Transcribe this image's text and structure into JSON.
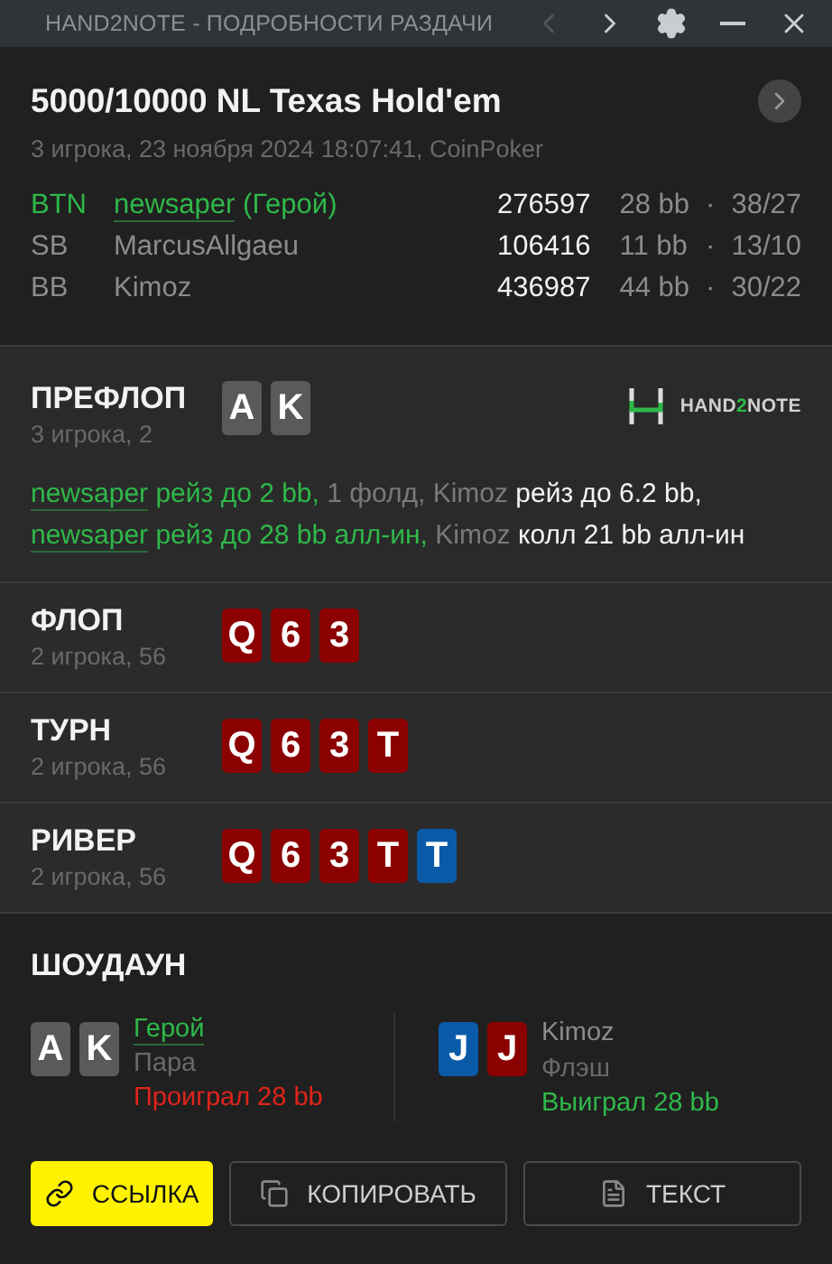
{
  "window": {
    "title": "HAND2NOTE - ПОДРОБНОСТИ РАЗДАЧИ",
    "prev_disabled": true
  },
  "hand": {
    "title": "5000/10000 NL Texas Hold'em",
    "subtitle": "3 игрока, 23 ноября 2024 18:07:41, CoinPoker",
    "players": [
      {
        "position": "BTN",
        "name": "newsaper",
        "hero_tag": "(Герой)",
        "hero": true,
        "stack": "276597",
        "bb": "28 bb",
        "sep": "·",
        "stats": "38/27"
      },
      {
        "position": "SB",
        "name": "MarcusAllgaeu",
        "hero": false,
        "stack": "106416",
        "bb": "11 bb",
        "sep": "·",
        "stats": "13/10"
      },
      {
        "position": "BB",
        "name": "Kimoz",
        "hero": false,
        "stack": "436987",
        "bb": "44 bb",
        "sep": "·",
        "stats": "30/22"
      }
    ]
  },
  "preflop": {
    "name": "ПРЕФЛОП",
    "info": "3 игрока, 2",
    "cards": [
      {
        "rank": "A",
        "color": "#5a5a5a"
      },
      {
        "rank": "K",
        "color": "#5a5a5a"
      }
    ],
    "logo": [
      "HAND",
      "2",
      "NOTE"
    ],
    "lines": [
      [
        {
          "text": "newsaper",
          "kind": "link"
        },
        {
          "text": " рейз до 2 bb,",
          "kind": "hero"
        },
        {
          "text": " 1 фолд, Kimoz",
          "kind": "muted"
        },
        {
          "text": " рейз до 6.2 bb,",
          "kind": "plain"
        }
      ],
      [
        {
          "text": "newsaper",
          "kind": "link"
        },
        {
          "text": " рейз до 28 bb алл-ин,",
          "kind": "hero"
        },
        {
          "text": " Kimoz",
          "kind": "muted"
        },
        {
          "text": " колл 21 bb алл-ин",
          "kind": "plain"
        }
      ]
    ]
  },
  "streets": [
    {
      "name": "ФЛОП",
      "info": "2 игрока, 56",
      "cards": [
        {
          "rank": "Q",
          "color": "#8b0000"
        },
        {
          "rank": "6",
          "color": "#8b0000"
        },
        {
          "rank": "3",
          "color": "#8b0000"
        }
      ]
    },
    {
      "name": "ТУРН",
      "info": "2 игрока, 56",
      "cards": [
        {
          "rank": "Q",
          "color": "#8b0000"
        },
        {
          "rank": "6",
          "color": "#8b0000"
        },
        {
          "rank": "3",
          "color": "#8b0000"
        },
        {
          "rank": "T",
          "color": "#8b0000"
        }
      ]
    },
    {
      "name": "РИВЕР",
      "info": "2 игрока, 56",
      "cards": [
        {
          "rank": "Q",
          "color": "#8b0000"
        },
        {
          "rank": "6",
          "color": "#8b0000"
        },
        {
          "rank": "3",
          "color": "#8b0000"
        },
        {
          "rank": "T",
          "color": "#8b0000"
        },
        {
          "rank": "T",
          "color": "#0a5aa8"
        }
      ]
    }
  ],
  "showdown": {
    "title": "ШОУДАУН",
    "players": [
      {
        "name": "Герой",
        "hero": true,
        "hand": "Пара",
        "result": "Проиграл 28 bb",
        "won": false,
        "cards": [
          {
            "rank": "A",
            "color": "#5a5a5a"
          },
          {
            "rank": "K",
            "color": "#5a5a5a"
          }
        ]
      },
      {
        "name": "Kimoz",
        "hero": false,
        "hand": "Флэш",
        "result": "Выиграл 28 bb",
        "won": true,
        "cards": [
          {
            "rank": "J",
            "color": "#0a5aa8"
          },
          {
            "rank": "J",
            "color": "#8b0000"
          }
        ]
      }
    ]
  },
  "buttons": [
    {
      "label": "ССЫЛКА",
      "kind": "primary"
    },
    {
      "label": "КОПИРОВАТЬ",
      "kind": "plain"
    },
    {
      "label": "ТЕКСТ",
      "kind": "plain"
    }
  ]
}
